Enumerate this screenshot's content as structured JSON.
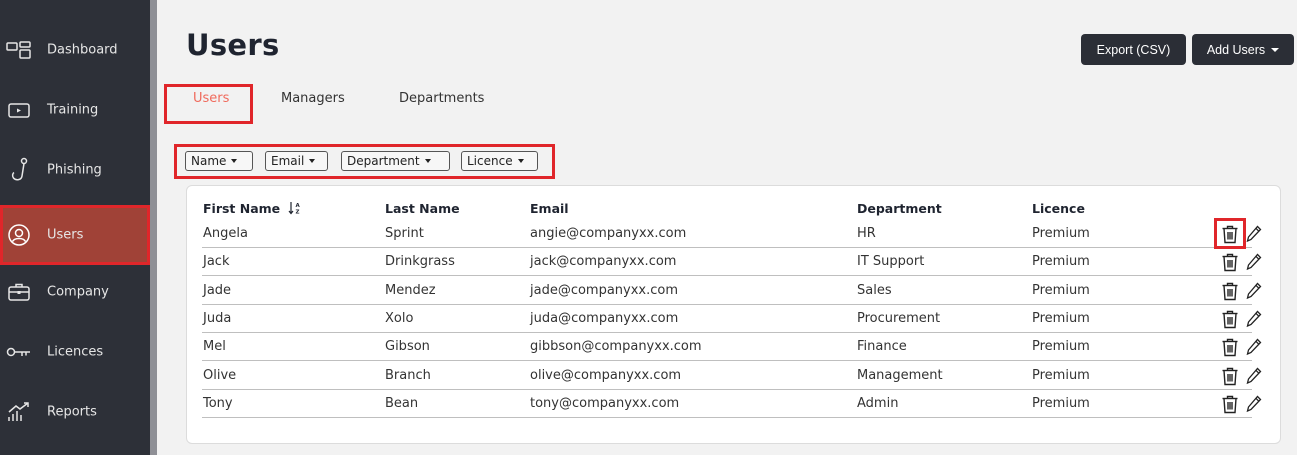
{
  "sidebar": {
    "items": [
      {
        "label": "Dashboard",
        "icon": "dashboard-icon"
      },
      {
        "label": "Training",
        "icon": "training-icon"
      },
      {
        "label": "Phishing",
        "icon": "phishing-hook-icon"
      },
      {
        "label": "Users",
        "icon": "user-icon",
        "active": true
      },
      {
        "label": "Company",
        "icon": "briefcase-icon"
      },
      {
        "label": "Licences",
        "icon": "key-icon"
      },
      {
        "label": "Reports",
        "icon": "reports-icon"
      }
    ]
  },
  "header": {
    "title": "Users",
    "export_label": "Export (CSV)",
    "add_label": "Add Users"
  },
  "tabs": [
    {
      "label": "Users",
      "active": true
    },
    {
      "label": "Managers"
    },
    {
      "label": "Departments"
    }
  ],
  "filters": [
    "Name",
    "Email",
    "Department",
    "Licence"
  ],
  "table": {
    "columns": [
      "First Name",
      "Last Name",
      "Email",
      "Department",
      "Licence"
    ],
    "sort_column": "First Name",
    "rows": [
      {
        "first": "Angela",
        "last": "Sprint",
        "email": "angie@companyxx.com",
        "department": "HR",
        "licence": "Premium"
      },
      {
        "first": "Jack",
        "last": "Drinkgrass",
        "email": "jack@companyxx.com",
        "department": "IT Support",
        "licence": "Premium"
      },
      {
        "first": "Jade",
        "last": "Mendez",
        "email": "jade@companyxx.com",
        "department": "Sales",
        "licence": "Premium"
      },
      {
        "first": "Juda",
        "last": "Xolo",
        "email": "juda@companyxx.com",
        "department": "Procurement",
        "licence": "Premium"
      },
      {
        "first": "Mel",
        "last": "Gibson",
        "email": "gibbson@companyxx.com",
        "department": "Finance",
        "licence": "Premium"
      },
      {
        "first": "Olive",
        "last": "Branch",
        "email": "olive@companyxx.com",
        "department": "Management",
        "licence": "Premium"
      },
      {
        "first": "Tony",
        "last": "Bean",
        "email": "tony@companyxx.com",
        "department": "Admin",
        "licence": "Premium"
      }
    ]
  },
  "colors": {
    "sidebar_bg": "#2d3038",
    "active_bg": "#a04237",
    "highlight": "#e0262a",
    "active_tab": "#f06a5c",
    "button_bg": "#2b2e36"
  }
}
